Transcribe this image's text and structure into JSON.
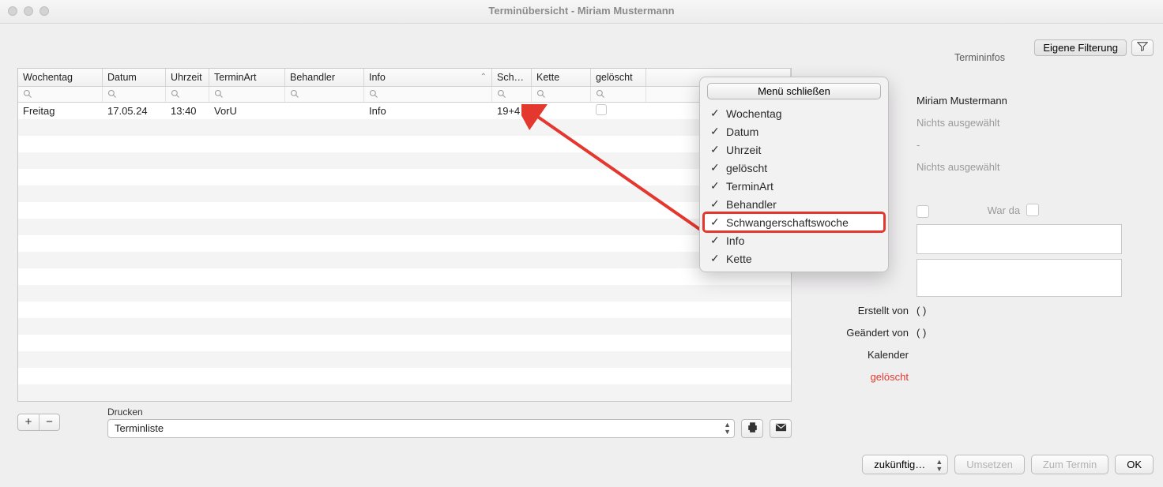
{
  "window": {
    "title": "Terminübersicht - Miriam Mustermann"
  },
  "toolbar": {
    "eigene_filterung": "Eigene Filterung"
  },
  "columns": {
    "wochentag": "Wochentag",
    "datum": "Datum",
    "uhrzeit": "Uhrzeit",
    "terminart": "TerminArt",
    "behandler": "Behandler",
    "info": "Info",
    "sch": "Sch…",
    "kette": "Kette",
    "geloescht": "gelöscht"
  },
  "rows": [
    {
      "wochentag": "Freitag",
      "datum": "17.05.24",
      "uhrzeit": "13:40",
      "terminart": "VorU",
      "behandler": "",
      "info": "Info",
      "sch": "19+4",
      "kette": "",
      "geloescht": false
    }
  ],
  "popup": {
    "close": "Menü schließen",
    "items": [
      "Wochentag",
      "Datum",
      "Uhrzeit",
      "gelöscht",
      "TerminArt",
      "Behandler",
      "Schwangerschaftswoche",
      "Info",
      "Kette"
    ],
    "highlight_index": 6
  },
  "side": {
    "header": "Termininfos",
    "name": "Miriam Mustermann",
    "nichts1": "Nichts ausgewählt",
    "dash": "-",
    "nichts2": "Nichts ausgewählt",
    "warda": "War da",
    "erstellt_lbl": "Erstellt von",
    "erstellt_val": "( )",
    "geaendert_lbl": "Geändert von",
    "geaendert_val": "( )",
    "kalender_lbl": "Kalender",
    "geloescht_lbl": "gelöscht"
  },
  "below": {
    "drucken": "Drucken",
    "terminliste": "Terminliste"
  },
  "bottom": {
    "zukuenftig": "zukünftig…",
    "umsetzen": "Umsetzen",
    "zum_termin": "Zum Termin",
    "ok": "OK"
  }
}
